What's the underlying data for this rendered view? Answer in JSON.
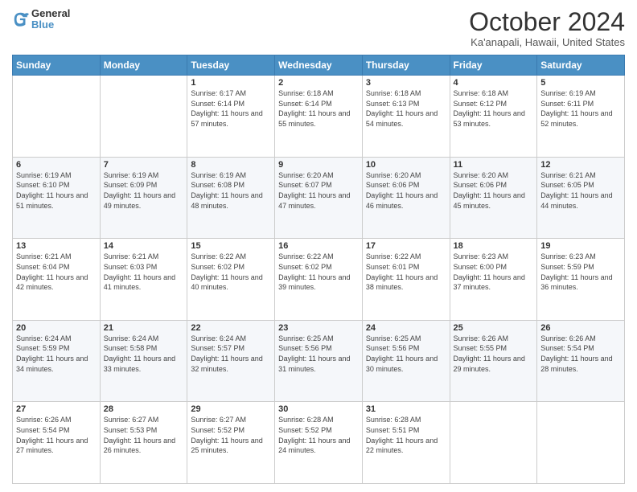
{
  "logo": {
    "line1": "General",
    "line2": "Blue"
  },
  "title": "October 2024",
  "subtitle": "Ka'anapali, Hawaii, United States",
  "weekdays": [
    "Sunday",
    "Monday",
    "Tuesday",
    "Wednesday",
    "Thursday",
    "Friday",
    "Saturday"
  ],
  "weeks": [
    [
      {
        "day": "",
        "info": ""
      },
      {
        "day": "",
        "info": ""
      },
      {
        "day": "1",
        "sunrise": "6:17 AM",
        "sunset": "6:14 PM",
        "daylight": "11 hours and 57 minutes."
      },
      {
        "day": "2",
        "sunrise": "6:18 AM",
        "sunset": "6:14 PM",
        "daylight": "11 hours and 55 minutes."
      },
      {
        "day": "3",
        "sunrise": "6:18 AM",
        "sunset": "6:13 PM",
        "daylight": "11 hours and 54 minutes."
      },
      {
        "day": "4",
        "sunrise": "6:18 AM",
        "sunset": "6:12 PM",
        "daylight": "11 hours and 53 minutes."
      },
      {
        "day": "5",
        "sunrise": "6:19 AM",
        "sunset": "6:11 PM",
        "daylight": "11 hours and 52 minutes."
      }
    ],
    [
      {
        "day": "6",
        "sunrise": "6:19 AM",
        "sunset": "6:10 PM",
        "daylight": "11 hours and 51 minutes."
      },
      {
        "day": "7",
        "sunrise": "6:19 AM",
        "sunset": "6:09 PM",
        "daylight": "11 hours and 49 minutes."
      },
      {
        "day": "8",
        "sunrise": "6:19 AM",
        "sunset": "6:08 PM",
        "daylight": "11 hours and 48 minutes."
      },
      {
        "day": "9",
        "sunrise": "6:20 AM",
        "sunset": "6:07 PM",
        "daylight": "11 hours and 47 minutes."
      },
      {
        "day": "10",
        "sunrise": "6:20 AM",
        "sunset": "6:06 PM",
        "daylight": "11 hours and 46 minutes."
      },
      {
        "day": "11",
        "sunrise": "6:20 AM",
        "sunset": "6:06 PM",
        "daylight": "11 hours and 45 minutes."
      },
      {
        "day": "12",
        "sunrise": "6:21 AM",
        "sunset": "6:05 PM",
        "daylight": "11 hours and 44 minutes."
      }
    ],
    [
      {
        "day": "13",
        "sunrise": "6:21 AM",
        "sunset": "6:04 PM",
        "daylight": "11 hours and 42 minutes."
      },
      {
        "day": "14",
        "sunrise": "6:21 AM",
        "sunset": "6:03 PM",
        "daylight": "11 hours and 41 minutes."
      },
      {
        "day": "15",
        "sunrise": "6:22 AM",
        "sunset": "6:02 PM",
        "daylight": "11 hours and 40 minutes."
      },
      {
        "day": "16",
        "sunrise": "6:22 AM",
        "sunset": "6:02 PM",
        "daylight": "11 hours and 39 minutes."
      },
      {
        "day": "17",
        "sunrise": "6:22 AM",
        "sunset": "6:01 PM",
        "daylight": "11 hours and 38 minutes."
      },
      {
        "day": "18",
        "sunrise": "6:23 AM",
        "sunset": "6:00 PM",
        "daylight": "11 hours and 37 minutes."
      },
      {
        "day": "19",
        "sunrise": "6:23 AM",
        "sunset": "5:59 PM",
        "daylight": "11 hours and 36 minutes."
      }
    ],
    [
      {
        "day": "20",
        "sunrise": "6:24 AM",
        "sunset": "5:59 PM",
        "daylight": "11 hours and 34 minutes."
      },
      {
        "day": "21",
        "sunrise": "6:24 AM",
        "sunset": "5:58 PM",
        "daylight": "11 hours and 33 minutes."
      },
      {
        "day": "22",
        "sunrise": "6:24 AM",
        "sunset": "5:57 PM",
        "daylight": "11 hours and 32 minutes."
      },
      {
        "day": "23",
        "sunrise": "6:25 AM",
        "sunset": "5:56 PM",
        "daylight": "11 hours and 31 minutes."
      },
      {
        "day": "24",
        "sunrise": "6:25 AM",
        "sunset": "5:56 PM",
        "daylight": "11 hours and 30 minutes."
      },
      {
        "day": "25",
        "sunrise": "6:26 AM",
        "sunset": "5:55 PM",
        "daylight": "11 hours and 29 minutes."
      },
      {
        "day": "26",
        "sunrise": "6:26 AM",
        "sunset": "5:54 PM",
        "daylight": "11 hours and 28 minutes."
      }
    ],
    [
      {
        "day": "27",
        "sunrise": "6:26 AM",
        "sunset": "5:54 PM",
        "daylight": "11 hours and 27 minutes."
      },
      {
        "day": "28",
        "sunrise": "6:27 AM",
        "sunset": "5:53 PM",
        "daylight": "11 hours and 26 minutes."
      },
      {
        "day": "29",
        "sunrise": "6:27 AM",
        "sunset": "5:52 PM",
        "daylight": "11 hours and 25 minutes."
      },
      {
        "day": "30",
        "sunrise": "6:28 AM",
        "sunset": "5:52 PM",
        "daylight": "11 hours and 24 minutes."
      },
      {
        "day": "31",
        "sunrise": "6:28 AM",
        "sunset": "5:51 PM",
        "daylight": "11 hours and 22 minutes."
      },
      {
        "day": "",
        "info": ""
      },
      {
        "day": "",
        "info": ""
      }
    ]
  ],
  "daylight_label": "Daylight:",
  "sunrise_label": "Sunrise:",
  "sunset_label": "Sunset:"
}
